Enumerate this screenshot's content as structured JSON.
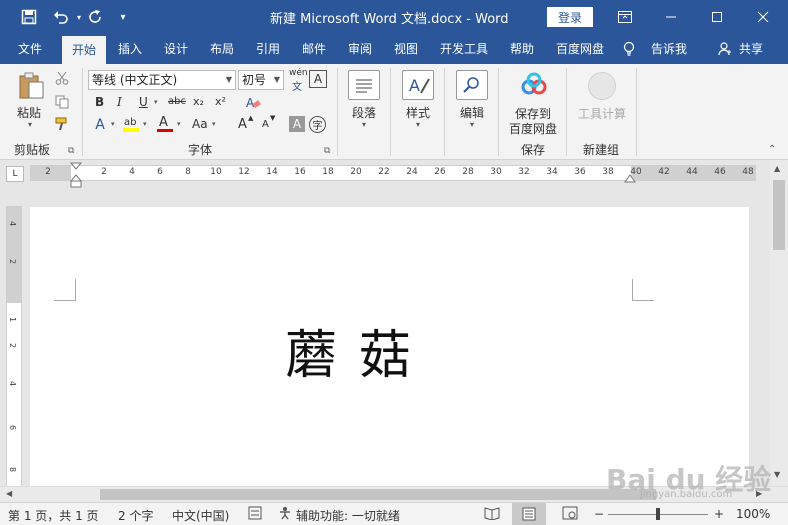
{
  "titlebar": {
    "title": "新建 Microsoft Word 文档.docx  -  Word",
    "login": "登录"
  },
  "tabs": [
    "文件",
    "开始",
    "插入",
    "设计",
    "布局",
    "引用",
    "邮件",
    "审阅",
    "视图",
    "开发工具",
    "帮助",
    "百度网盘",
    "告诉我",
    "共享"
  ],
  "ribbon": {
    "clipboard": {
      "paste": "粘贴",
      "label": "剪贴板"
    },
    "font": {
      "name": "等线 (中文正文)",
      "size": "初号",
      "pinyin": "wén",
      "bold": "B",
      "italic": "I",
      "underline": "U",
      "strike": "abc",
      "sub": "x₂",
      "sup": "x²",
      "grow": "A",
      "shrink": "A",
      "case": "Aa",
      "label": "字体"
    },
    "paragraph": {
      "label": "段落"
    },
    "styles": {
      "label": "样式"
    },
    "editing": {
      "label": "编辑"
    },
    "save": {
      "line1": "保存到",
      "line2": "百度网盘",
      "label": "保存"
    },
    "newgroup": {
      "tool": "工具计算",
      "label": "新建组"
    }
  },
  "ruler": {
    "numbers": [
      "2",
      "2",
      "4",
      "6",
      "8",
      "10",
      "12",
      "14",
      "16",
      "18",
      "20",
      "22",
      "24",
      "26",
      "28",
      "30",
      "32",
      "34",
      "36",
      "38",
      "40",
      "42",
      "44",
      "46",
      "48"
    ],
    "vnumbers": [
      "4",
      "2",
      "1",
      "2",
      "4",
      "6",
      "8"
    ]
  },
  "document": {
    "text": "蘑菇"
  },
  "status": {
    "page": "第 1 页，共 1 页",
    "words": "2 个字",
    "language": "中文(中国)",
    "accessibility": "辅助功能: 一切就绪",
    "zoom": "100%"
  },
  "watermark": {
    "text": "Bai du 经验",
    "sub": "jingyan.baidu.com"
  },
  "colors": {
    "brand": "#2b579a",
    "ribbon": "#f3f3f3",
    "highlight": "#ffff00",
    "font_color": "#e00000"
  }
}
